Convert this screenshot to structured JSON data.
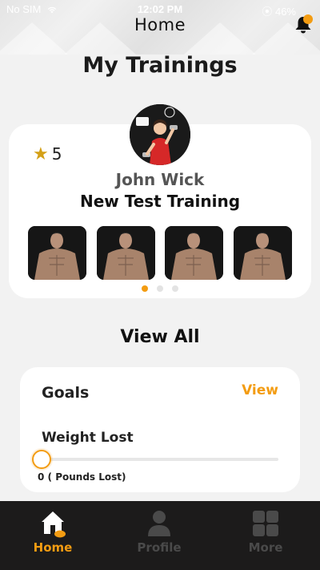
{
  "status_bar": {
    "carrier": "No SIM",
    "time": "12:02 PM",
    "battery": "46%"
  },
  "header": {
    "title": "Home",
    "notification_icon": "bell-icon",
    "accent_color": "#f39c12"
  },
  "section": {
    "title": "My Trainings"
  },
  "training_card": {
    "rating": "5",
    "trainer_name": "John Wick",
    "training_name": "New Test Training",
    "thumbnails": [
      "workout-thumbnail",
      "workout-thumbnail",
      "workout-thumbnail",
      "workout-thumbnail"
    ],
    "pager": {
      "pages": 3,
      "active": 0
    }
  },
  "view_all_label": "View All",
  "goals": {
    "title": "Goals",
    "view_label": "View",
    "weight_label": "Weight Lost",
    "pounds_lost_text": "0 ( Pounds Lost)",
    "progress": 0
  },
  "bottom_nav": {
    "items": [
      {
        "label": "Home",
        "icon": "home-icon",
        "active": true
      },
      {
        "label": "Profile",
        "icon": "profile-icon",
        "active": false
      },
      {
        "label": "More",
        "icon": "grid-icon",
        "active": false
      }
    ]
  }
}
